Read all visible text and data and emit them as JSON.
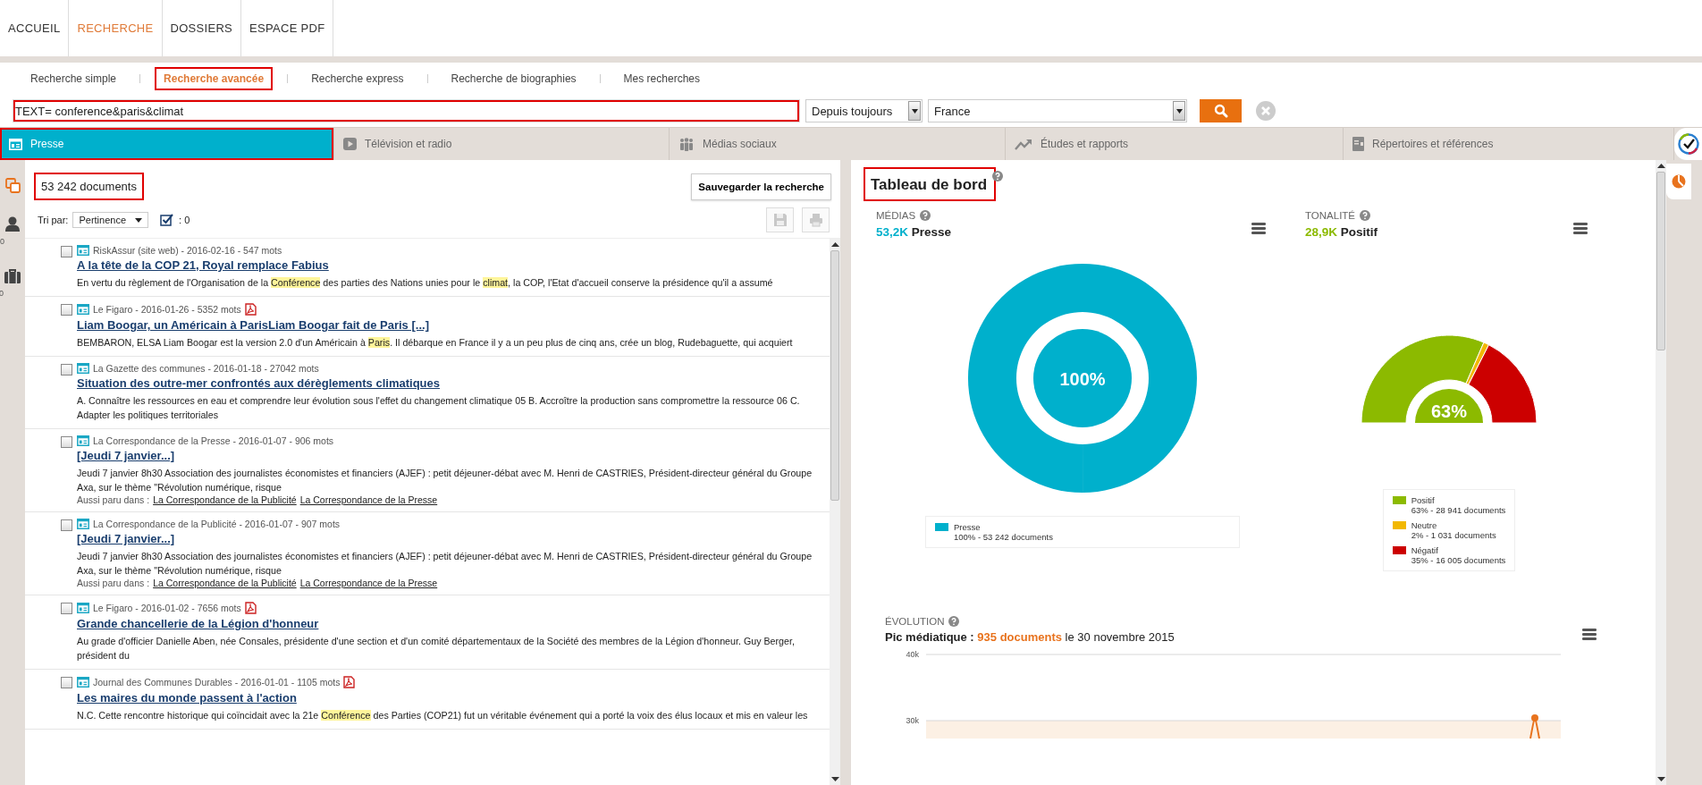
{
  "main_nav": [
    {
      "label": "ACCUEIL",
      "selected": false
    },
    {
      "label": "RECHERCHE",
      "selected": true
    },
    {
      "label": "DOSSIERS",
      "selected": false
    },
    {
      "label": "ESPACE PDF",
      "selected": false
    }
  ],
  "search_tabs": [
    {
      "label": "Recherche simple",
      "selected": false,
      "highlighted": false
    },
    {
      "label": "Recherche avancée",
      "selected": true,
      "highlighted": true
    },
    {
      "label": "Recherche express",
      "selected": false,
      "highlighted": false
    },
    {
      "label": "Recherche de biographies",
      "selected": false,
      "highlighted": false
    },
    {
      "label": "Mes recherches",
      "selected": false,
      "highlighted": false
    }
  ],
  "search": {
    "query": "TEXT= conference&paris&climat",
    "query_highlighted": true,
    "period": "Depuis toujours",
    "region": "France"
  },
  "categories": [
    {
      "label": "Presse",
      "kind": "press",
      "selected": true,
      "highlighted": true
    },
    {
      "label": "Télévision et radio",
      "kind": "tv",
      "selected": false,
      "highlighted": false
    },
    {
      "label": "Médias sociaux",
      "kind": "social",
      "selected": false,
      "highlighted": false
    },
    {
      "label": "Études et rapports",
      "kind": "trend",
      "selected": false,
      "highlighted": false
    },
    {
      "label": "Répertoires et références",
      "kind": "directory",
      "selected": false,
      "highlighted": false
    }
  ],
  "side_rail": [
    {
      "kind": "copy"
    },
    {
      "kind": "person",
      "count": "0"
    },
    {
      "kind": "briefcase",
      "count": "0"
    }
  ],
  "results": {
    "count": "53 242 documents",
    "count_highlighted": true,
    "save_button": "Sauvegarder la recherche",
    "sort_label": "Tri par:",
    "sort_value": "Pertinence",
    "checked_count": ": 0",
    "items": [
      {
        "checked": false,
        "meta": "RiskAssur (site web) - 2016-02-16 - 547 mots",
        "pdf": false,
        "title": "A la tête de la COP 21, Royal remplace Fabius",
        "snippet": [
          {
            "text": "En vertu du règlement de l'Organisation de la ",
            "highlighted": false
          },
          {
            "text": "Conférence",
            "highlighted": true
          },
          {
            "text": " des parties des Nations unies pour le ",
            "highlighted": false
          },
          {
            "text": "climat",
            "highlighted": true
          },
          {
            "text": ", la COP, l'Etat d'accueil conserve la présidence qu'il a assumé",
            "highlighted": false
          }
        ]
      },
      {
        "checked": false,
        "meta": "Le Figaro - 2016-01-26 - 5352 mots",
        "pdf": true,
        "title": "Liam Boogar, un Américain à ParisLiam Boogar fait de Paris [...]",
        "snippet": [
          {
            "text": "BEMBARON, ELSA Liam Boogar est la version 2.0 d'un Américain à ",
            "highlighted": false
          },
          {
            "text": "Paris",
            "highlighted": true
          },
          {
            "text": ". Il débarque en France il y a un peu plus de cinq ans, crée un blog, Rudebaguette, qui acquiert",
            "highlighted": false
          }
        ]
      },
      {
        "checked": false,
        "meta": "La Gazette des communes - 2016-01-18 - 27042 mots",
        "pdf": false,
        "title": "Situation des outre-mer confrontés aux dérèglements climatiques",
        "snippet": [
          {
            "text": "A. Connaître les ressources en eau et comprendre leur évolution sous l'effet du changement climatique 05 B. Accroître la production sans compromettre la ressource 06 C. Adapter les politiques territoriales",
            "highlighted": false
          }
        ]
      },
      {
        "checked": false,
        "meta": "La Correspondance de la Presse - 2016-01-07 - 906 mots",
        "pdf": false,
        "title": "[Jeudi 7 janvier...]",
        "snippet": [
          {
            "text": "Jeudi 7 janvier 8h30 Association des journalistes économistes et financiers (AJEF) : petit déjeuner-débat avec M. Henri de CASTRIES, Président-directeur général du Groupe Axa, sur le thème \"Révolution numérique, risque",
            "highlighted": false
          }
        ],
        "also_label": "Aussi paru dans :",
        "also_in": [
          "La Correspondance de la Publicité",
          "La Correspondance de la Presse"
        ]
      },
      {
        "checked": false,
        "meta": "La Correspondance de la Publicité - 2016-01-07 - 907 mots",
        "pdf": false,
        "title": "[Jeudi 7 janvier...]",
        "snippet": [
          {
            "text": "Jeudi 7 janvier 8h30 Association des journalistes économistes et financiers (AJEF) : petit déjeuner-débat avec M. Henri de CASTRIES, Président-directeur général du Groupe Axa, sur le thème \"Révolution numérique, risque",
            "highlighted": false
          }
        ],
        "also_label": "Aussi paru dans :",
        "also_in": [
          "La Correspondance de la Publicité",
          "La Correspondance de la Presse"
        ]
      },
      {
        "checked": false,
        "meta": "Le Figaro - 2016-01-02 - 7656 mots",
        "pdf": true,
        "title": "Grande chancellerie de la Légion d'honneur",
        "snippet": [
          {
            "text": "Au grade d'officier Danielle Aben, née Consales, présidente d'une section et d'un comité départementaux de la Société des membres de la Légion d'honneur. Guy Berger, président du",
            "highlighted": false
          }
        ]
      },
      {
        "checked": false,
        "meta": "Journal des Communes Durables - 2016-01-01 - 1105 mots",
        "pdf": true,
        "title": "Les maires du monde passent à l'action",
        "snippet": [
          {
            "text": "N.C. Cette rencontre historique qui coïncidait avec la 21e ",
            "highlighted": false
          },
          {
            "text": "Conférence",
            "highlighted": true
          },
          {
            "text": " des Parties (COP21) fut un véritable événement qui a porté la voix des élus locaux et mis en valeur les",
            "highlighted": false
          }
        ]
      }
    ]
  },
  "dashboard": {
    "title": "Tableau de bord",
    "title_highlighted": true,
    "medias": {
      "label": "MÉDIAS",
      "figure": "53,2K",
      "figure_label": "Presse",
      "center_label": "100%",
      "legend": [
        {
          "name": "Presse",
          "color": "#00b0cc",
          "detail": "100% - 53 242 documents"
        }
      ]
    },
    "tonality": {
      "label": "TONALITÉ",
      "figure": "28,9K",
      "figure_label": "Positif",
      "center_label": "63%",
      "legend": [
        {
          "color": "#8cba00",
          "detail": "63% - 28 941 documents"
        },
        {
          "color": "#f2b800",
          "detail": "2% - 1 031 documents"
        },
        {
          "color": "#cc0000",
          "detail": "35% - 16 005 documents"
        }
      ],
      "chart_data": {
        "type": "donut",
        "categories": [
          "Positif",
          "Neutre",
          "Négatif"
        ],
        "values": [
          63,
          2,
          35
        ]
      }
    },
    "evolution": {
      "label": "ÉVOLUTION",
      "peak_label": "Pic médiatique :",
      "peak_value": "935 documents",
      "peak_date": "le 30 novembre 2015",
      "axis_labels": [
        "40k",
        "30k"
      ]
    }
  }
}
